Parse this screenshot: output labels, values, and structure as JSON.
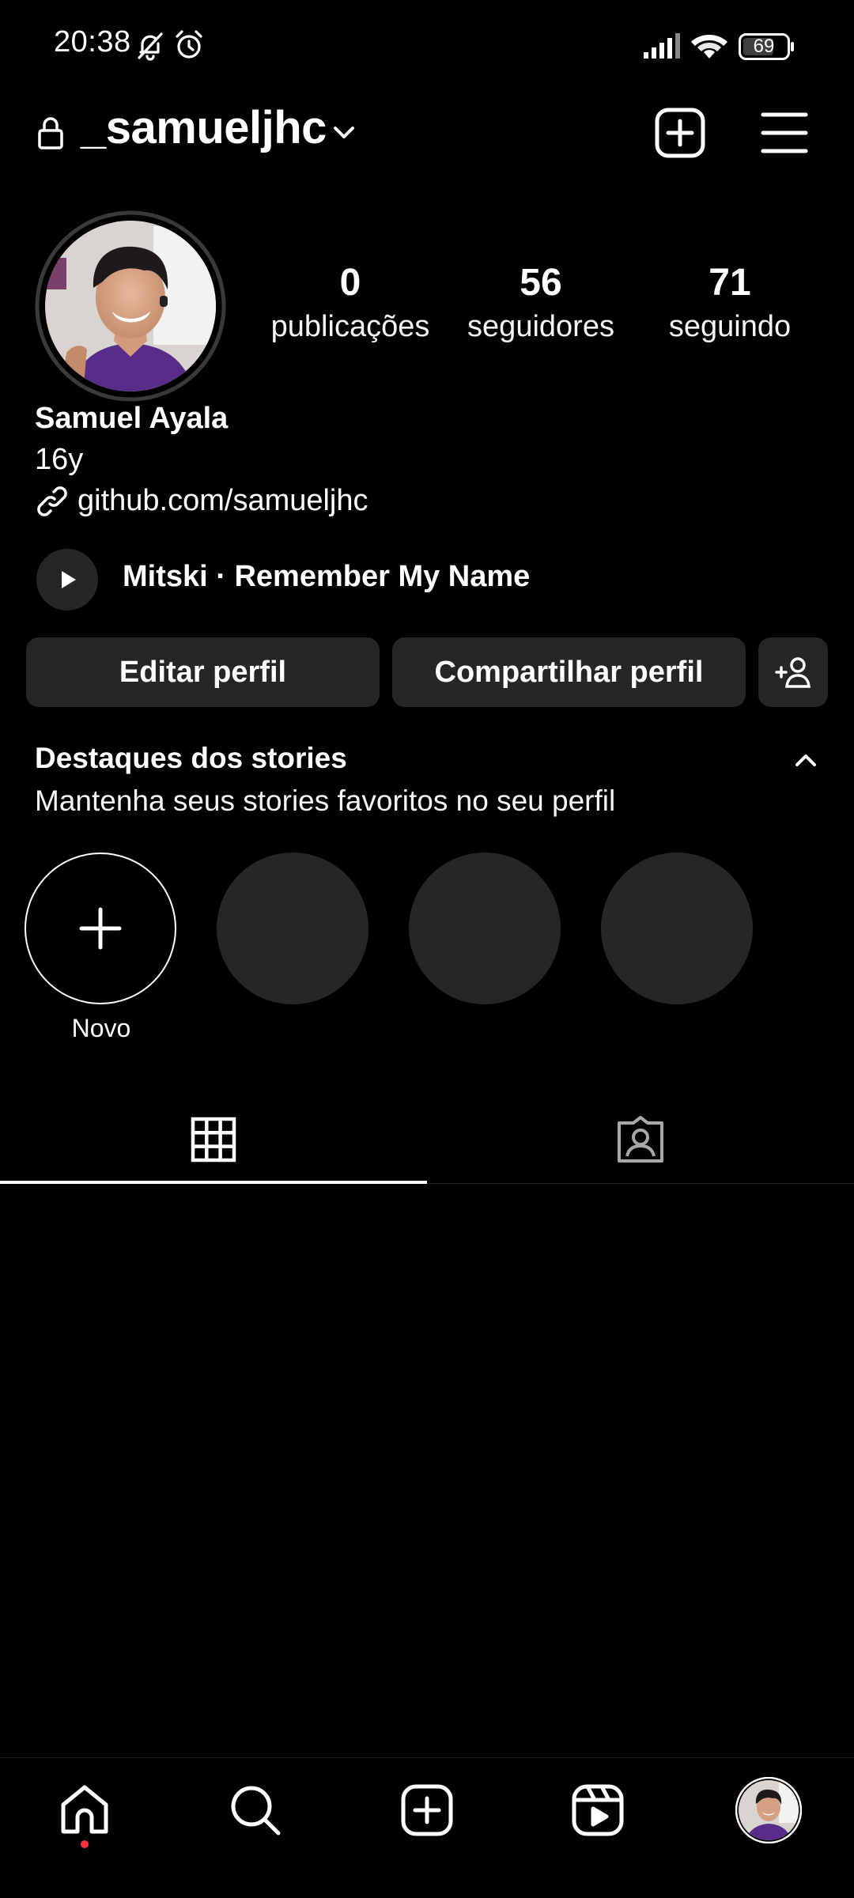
{
  "status_bar": {
    "time": "20:38",
    "battery": "69",
    "icons": [
      "bell-muted-icon",
      "alarm-icon",
      "signal-icon",
      "wifi-icon",
      "battery-icon"
    ]
  },
  "header": {
    "username": "_samueljhc",
    "icons": [
      "lock-icon",
      "chevron-down-icon",
      "create-plus-icon",
      "menu-icon"
    ]
  },
  "profile": {
    "stats": [
      {
        "value": "0",
        "label": "publicações"
      },
      {
        "value": "56",
        "label": "seguidores"
      },
      {
        "value": "71",
        "label": "seguindo"
      }
    ],
    "name": "Samuel Ayala",
    "bio": "16y",
    "link": "github.com/samueljhc",
    "music": "Mitski · Remember My Name"
  },
  "buttons": {
    "edit": "Editar perfil",
    "share": "Compartilhar perfil",
    "discover_icon": "add-person-icon"
  },
  "highlights": {
    "title": "Destaques dos stories",
    "subtitle": "Mantenha seus stories favoritos no seu perfil",
    "new_label": "Novo"
  },
  "tabs": [
    "grid-icon",
    "tagged-icon"
  ],
  "bottom_nav": [
    "home-icon",
    "search-icon",
    "create-icon",
    "reels-icon",
    "profile-avatar"
  ],
  "colors": {
    "background": "#000000",
    "button_bg": "#262626",
    "notification_dot": "#ff3040"
  }
}
